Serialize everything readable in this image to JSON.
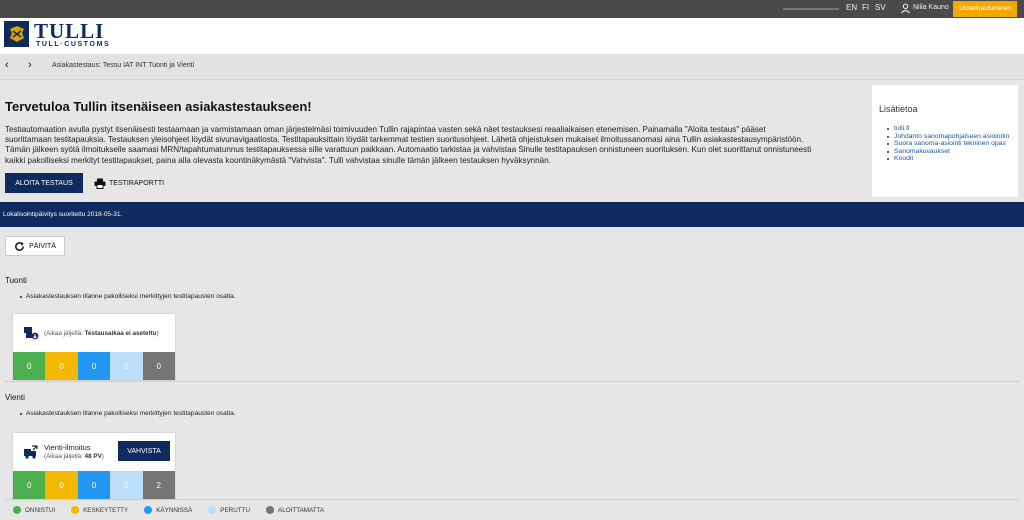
{
  "topbar": {
    "languages": [
      "EN",
      "FI",
      "SV"
    ],
    "user_name": "Niila Kauno",
    "logout_label": "Uloskirjautuminen"
  },
  "header": {
    "logo_title": "TULLI",
    "logo_subtitle": "TULL·CUSTOMS"
  },
  "nav": {
    "back_glyph": "‹",
    "forward_glyph": "›",
    "breadcrumb": "Asiakastestaus: Tessu IAT INT Tuonti ja Vienti"
  },
  "main": {
    "heading": "Tervetuloa Tullin itsenäiseen asiakastestaukseen!",
    "intro_lines": [
      "Testiautomaation avulla pystyt itsenäisesti testaamaan ja varmistamaan oman järjestelmäsi toimivuuden Tullin rajapintaa vasten sekä näet testauksesi reaaliaikaisen etenemisen. Painamalla \"Aloita testaus\" pääset",
      "suorittamaan testitapauksia. Testauksen yleisohjeet löydät sivunavigaatiosta. Testitapauksittain löydät tarkemmat testien suoritusohjeet. Lähetä ohjeistuksen mukaiset ilmoitussanomasi aina Tullin asiakastestausympäristöön.",
      "Tämän jälkeen syötä ilmoitukselle saamasi MRN/tapahtumatunnus testitapauksessa sille varattuun paikkaan. Automaatio tarkistaa ja vahvistaa Sinulle testitapauksen onnistuneen suorituksen. Kun olet suorittanut onnistuneesti",
      "kaikki pakolliseksi merkityt testitapaukset, paina alla olevasta koontinäkymästä \"Vahvista\". Tulli vahvistaa sinulle tämän jälkeen testauksen hyväksynnän."
    ],
    "start_label": "ALOITA TESTAUS",
    "report_label": "TESTIRAPORTTI"
  },
  "sidebar": {
    "title": "Lisätietoa",
    "links": [
      "tulli.fi",
      "Johdanto sanomapohjaiseen asiointiin",
      "Suora sanoma-asiointi tekninen opas",
      "Sanomakuvaukset",
      "Koodit"
    ]
  },
  "banner": {
    "text": "Lokalisointipäivitys suoritettu 2018-05-31."
  },
  "refresh_label": "PÄIVITÄ",
  "sections": {
    "import": {
      "title": "Tuonti",
      "note": "Asiakastestauksen tilanne pakolliseksi merkittyjen testitapausten osalta.",
      "time_prefix": "(Aikaa jäljellä: ",
      "time_value": "Testausaikaa ei asetettu",
      "time_suffix": ")",
      "counts": [
        "0",
        "0",
        "0",
        "0",
        "0"
      ]
    },
    "export": {
      "title": "Vienti",
      "note": "Asiakastestauksen tilanne pakolliseksi merkittyjen testitapausten osalta.",
      "case_name": "Vienti-ilmoitus",
      "time_prefix": "(Aikaa jäljellä: ",
      "time_value": "48 PV",
      "time_suffix": ")",
      "confirm_label": "VAHVISTA",
      "counts": [
        "0",
        "0",
        "0",
        "0",
        "2"
      ]
    }
  },
  "legend": {
    "items": [
      {
        "label": "ONNISTUI",
        "color": "#4caf50"
      },
      {
        "label": "KESKEYTETTY",
        "color": "#f5b800"
      },
      {
        "label": "KÄYNNISSÄ",
        "color": "#2196f3"
      },
      {
        "label": "PERUTTU",
        "color": "#bbdefb"
      },
      {
        "label": "ALOITTAMATTA",
        "color": "#757575"
      }
    ]
  },
  "colors": {
    "brand": "#0f2a5e",
    "accent": "#f3a800",
    "status_success": "#4caf50",
    "status_interrupted": "#f5b800",
    "status_running": "#2196f3",
    "status_cancelled": "#bbdefb",
    "status_not_started": "#757575"
  },
  "icons": {
    "user": "user-icon",
    "printer": "printer-icon",
    "refresh": "refresh-icon",
    "import_case": "import-case-icon",
    "export_case": "export-case-icon"
  }
}
